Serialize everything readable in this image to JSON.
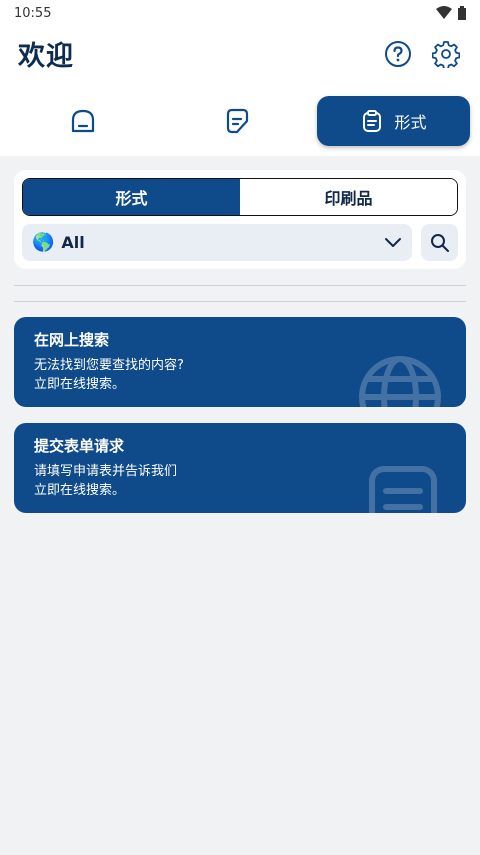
{
  "status_bar": {
    "time": "10:55",
    "icons": [
      "wifi-icon",
      "battery-icon"
    ]
  },
  "header": {
    "title": "欢迎",
    "help_icon": "help-icon",
    "settings_icon": "gear-icon"
  },
  "nav": {
    "tabs": [
      {
        "icon": "home-icon",
        "label": ""
      },
      {
        "icon": "document-icon",
        "label": ""
      },
      {
        "icon": "clipboard-icon",
        "label": "形式",
        "selected": true
      }
    ]
  },
  "filter": {
    "segments": [
      {
        "label": "形式",
        "selected": true
      },
      {
        "label": "印刷品",
        "selected": false
      }
    ],
    "select": {
      "flag": "🌎",
      "value": "All"
    }
  },
  "cards": [
    {
      "title": "在网上搜索",
      "line1": "无法找到您要查找的内容?",
      "line2": "立即在线搜索。",
      "icon": "globe-icon"
    },
    {
      "title": "提交表单请求",
      "line1": "请填写申请表并告诉我们",
      "line2": "立即在线搜索。",
      "icon": "form-icon"
    }
  ],
  "colors": {
    "primary": "#0f4a8a",
    "title": "#0e2c52",
    "background": "#f1f2f4"
  }
}
